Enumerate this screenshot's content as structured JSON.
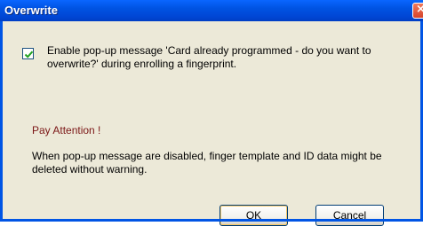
{
  "window": {
    "title": "Overwrite",
    "close_glyph": "×"
  },
  "option": {
    "checked": true,
    "label": "Enable pop-up message 'Card already programmed - do you want to overwrite?' during enrolling a fingerprint."
  },
  "attention": {
    "heading": "Pay Attention !",
    "message": "When pop-up message are disabled, finger template and ID data might be deleted without warning."
  },
  "buttons": {
    "ok_label": "OK",
    "cancel_label": "Cancel"
  },
  "colors": {
    "titlebar": "#0055e5",
    "dialog_bg": "#ece9d8",
    "attention_text": "#7b1616",
    "checkmark": "#21a121"
  }
}
